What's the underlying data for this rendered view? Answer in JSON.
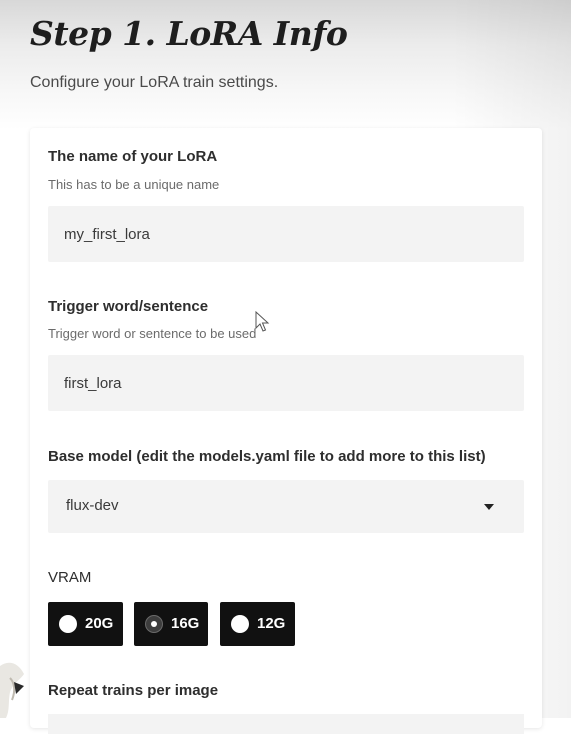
{
  "header": {
    "title": "Step 1. LoRA Info",
    "subtitle": "Configure your LoRA train settings."
  },
  "form": {
    "lora_name": {
      "label": "The name of your LoRA",
      "hint": "This has to be a unique name",
      "value": "my_first_lora"
    },
    "trigger_word": {
      "label": "Trigger word/sentence",
      "hint": "Trigger word or sentence to be used",
      "value": "first_lora"
    },
    "base_model": {
      "label": "Base model (edit the models.yaml file to add more to this list)",
      "selected": "flux-dev"
    },
    "vram": {
      "label": "VRAM",
      "options": [
        "20G",
        "16G",
        "12G"
      ],
      "selected": "16G"
    },
    "repeat_trains": {
      "label": "Repeat trains per image"
    }
  },
  "icons": {
    "dropdown": "chevron-down-icon",
    "pointer": "cursor-icon"
  },
  "colors": {
    "input_bg": "#f3f3f3",
    "radio_bg": "#111111",
    "text": "#2e2e2e"
  }
}
